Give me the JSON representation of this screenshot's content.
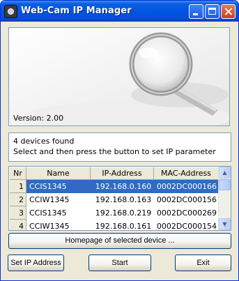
{
  "window": {
    "title": "Web-Cam IP Manager"
  },
  "banner": {
    "version": "Version: 2.00"
  },
  "messages": {
    "line1": "4 devices found",
    "line2": "Select and then press the button to set IP parameter"
  },
  "table": {
    "headers": {
      "nr": "Nr",
      "name": "Name",
      "ip": "IP-Address",
      "mac": "MAC-Address"
    },
    "rows": [
      {
        "nr": "1",
        "name": "CCIS1345",
        "ip": "192.168.0.160",
        "mac": "0002DC000166",
        "selected": true
      },
      {
        "nr": "2",
        "name": "CCIW1345",
        "ip": "192.168.0.163",
        "mac": "0002DC000156",
        "selected": false
      },
      {
        "nr": "3",
        "name": "CCIS1345",
        "ip": "192.168.0.219",
        "mac": "0002DC000269",
        "selected": false
      },
      {
        "nr": "4",
        "name": "CCIW1345",
        "ip": "192.168.0.161",
        "mac": "0002DC000154",
        "selected": false
      }
    ]
  },
  "buttons": {
    "homepage": "Homepage of selected device ...",
    "set_ip": "Set IP Address",
    "start": "Start",
    "exit": "Exit"
  },
  "icons": {
    "app": "webcam-icon",
    "scroll_up": "arrow-up-icon",
    "scroll_down": "arrow-down-icon"
  },
  "colors": {
    "title_bar": "#0054e3",
    "selection": "#316ac5",
    "close_button": "#d9542b"
  }
}
